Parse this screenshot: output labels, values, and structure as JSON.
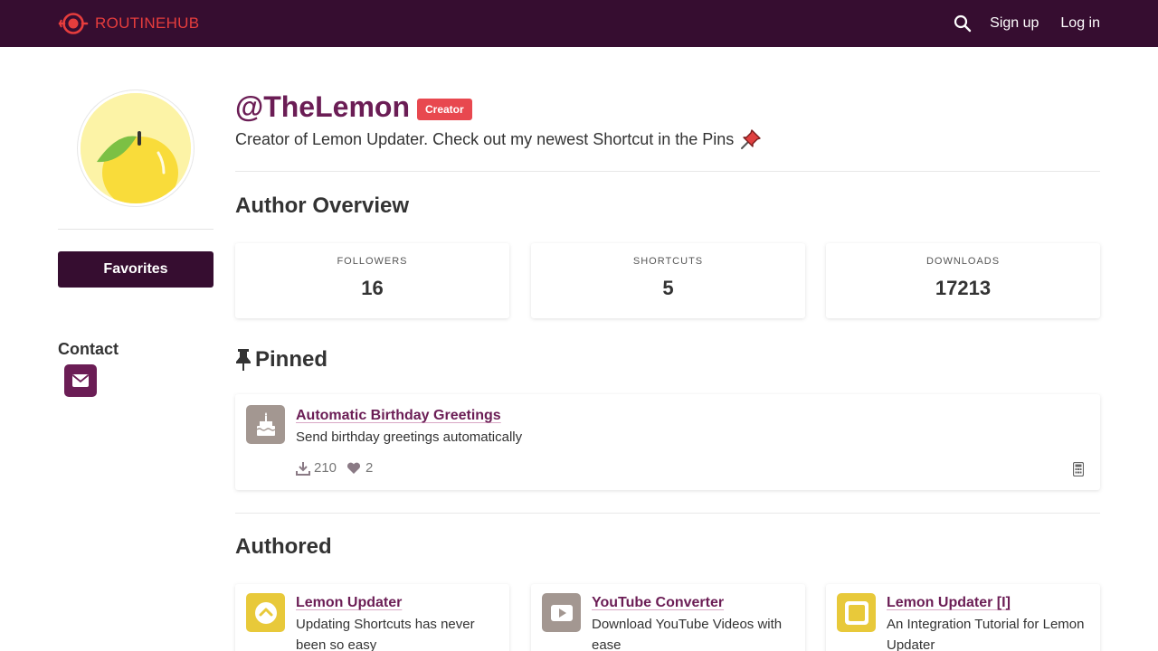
{
  "nav": {
    "brand": "ROUTINEHUB",
    "signup": "Sign up",
    "login": "Log in"
  },
  "profile": {
    "username": "@TheLemon",
    "badge": "Creator",
    "bio": "Creator of Lemon Updater. Check out my newest Shortcut in the Pins",
    "favorites_label": "Favorites",
    "contact_title": "Contact"
  },
  "overview": {
    "title": "Author Overview",
    "stats": [
      {
        "label": "FOLLOWERS",
        "value": "16"
      },
      {
        "label": "SHORTCUTS",
        "value": "5"
      },
      {
        "label": "DOWNLOADS",
        "value": "17213"
      }
    ]
  },
  "pinned": {
    "title": "Pinned",
    "item": {
      "title": "Automatic Birthday Greetings",
      "description": "Send birthday greetings automatically",
      "downloads": "210",
      "likes": "2",
      "icon": "birthday-cake-icon"
    }
  },
  "authored": {
    "title": "Authored",
    "items": [
      {
        "title": "Lemon Updater",
        "description": "Updating Shortcuts has never been so easy",
        "icon": "chevron-up-icon",
        "color": "#e8c93a"
      },
      {
        "title": "YouTube Converter",
        "description": "Download YouTube Videos with ease",
        "icon": "play-icon",
        "color": "#a39791"
      },
      {
        "title": "Lemon Updater [I]",
        "description": "An Integration Tutorial for Lemon Updater",
        "icon": "square-icon",
        "color": "#e8c93a"
      }
    ]
  },
  "colors": {
    "nav_bg": "#360d30",
    "accent": "#6b1d55",
    "brand_red": "#e63d3d",
    "badge": "#e8484f"
  }
}
